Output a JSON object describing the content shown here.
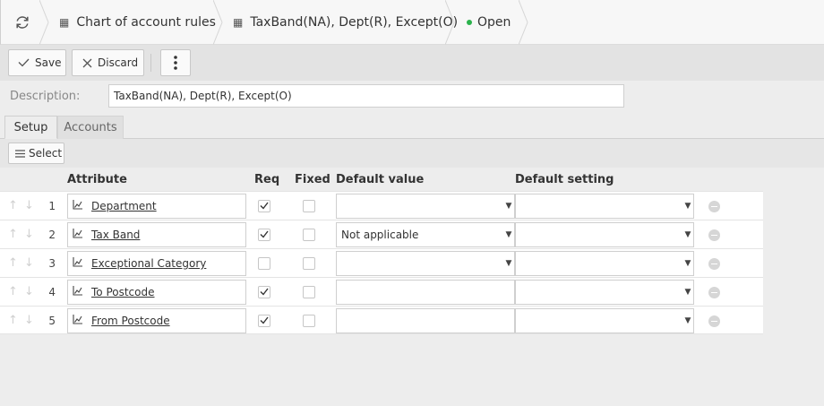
{
  "breadcrumb": {
    "refresh_icon": "refresh-icon",
    "items": [
      {
        "label": "Chart of account rules",
        "icon": "grid-icon"
      },
      {
        "label": "TaxBand(NA), Dept(R), Except(O)",
        "icon": "grid-icon"
      },
      {
        "label": "Open",
        "icon": "status-dot",
        "color": "#2bb24c"
      }
    ]
  },
  "toolbar": {
    "save_label": "Save",
    "discard_label": "Discard",
    "more_icon": "more-vertical-icon"
  },
  "description": {
    "label": "Description:",
    "value": "TaxBand(NA), Dept(R), Except(O)"
  },
  "tabs": [
    {
      "label": "Setup",
      "active": true
    },
    {
      "label": "Accounts",
      "active": false
    }
  ],
  "select_button": {
    "label": "Select",
    "icon": "menu-icon"
  },
  "grid": {
    "columns": {
      "attribute": "Attribute",
      "req": "Req",
      "fixed": "Fixed",
      "default_value": "Default value",
      "default_setting": "Default setting"
    },
    "rows": [
      {
        "num": "1",
        "attribute": "Department",
        "req": true,
        "fixed": false,
        "default_value": "",
        "default_value_dropdown": true,
        "default_setting": ""
      },
      {
        "num": "2",
        "attribute": "Tax Band",
        "req": true,
        "fixed": false,
        "default_value": "Not applicable",
        "default_value_dropdown": true,
        "default_setting": ""
      },
      {
        "num": "3",
        "attribute": "Exceptional Category",
        "req": false,
        "fixed": false,
        "default_value": "",
        "default_value_dropdown": true,
        "default_setting": ""
      },
      {
        "num": "4",
        "attribute": "To Postcode",
        "req": true,
        "fixed": false,
        "default_value": "",
        "default_value_dropdown": false,
        "default_setting": ""
      },
      {
        "num": "5",
        "attribute": "From Postcode",
        "req": true,
        "fixed": false,
        "default_value": "",
        "default_value_dropdown": false,
        "default_setting": ""
      }
    ]
  }
}
